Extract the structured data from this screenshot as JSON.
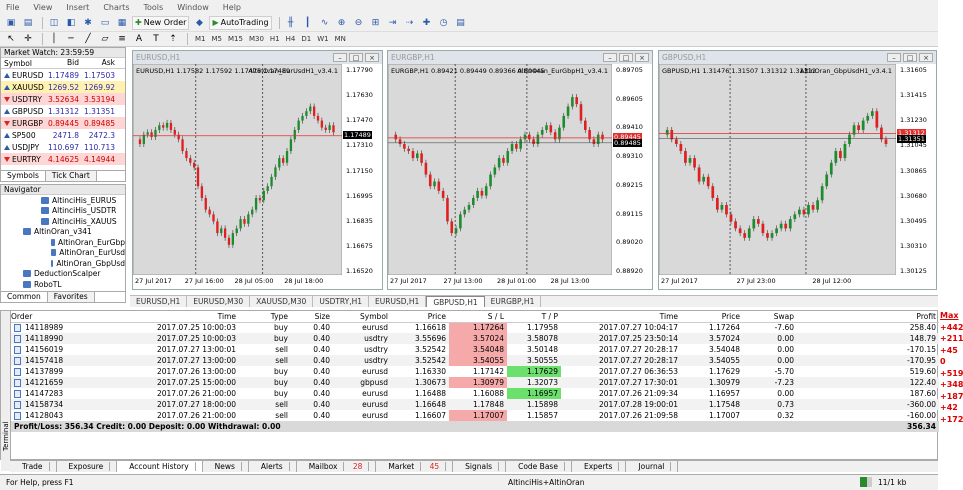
{
  "menu": [
    "File",
    "View",
    "Insert",
    "Charts",
    "Tools",
    "Window",
    "Help"
  ],
  "toolbar": {
    "new_order": "New Order",
    "autotrading": "AutoTrading"
  },
  "timeframes": [
    "M1",
    "M5",
    "M15",
    "M30",
    "H1",
    "H4",
    "D1",
    "W1",
    "MN"
  ],
  "market_watch": {
    "title": "Market Watch: 23:59:59",
    "columns": [
      "Symbol",
      "Bid",
      "Ask"
    ],
    "rows": [
      {
        "symbol": "EURUSD",
        "bid": "1.17489",
        "ask": "1.17503",
        "dir": "up",
        "bg": "#ffffff"
      },
      {
        "symbol": "XAUUSD",
        "bid": "1269.52",
        "ask": "1269.92",
        "dir": "up",
        "bg": "#fff2b0"
      },
      {
        "symbol": "USDTRY",
        "bid": "3.52634",
        "ask": "3.53194",
        "dir": "dn",
        "bg": "#ffd6d6"
      },
      {
        "symbol": "GBPUSD",
        "bid": "1.31312",
        "ask": "1.31351",
        "dir": "up",
        "bg": "#ffffff"
      },
      {
        "symbol": "EURGBP",
        "bid": "0.89445",
        "ask": "0.89485",
        "dir": "dn",
        "bg": "#ffd6d6"
      },
      {
        "symbol": "SP500",
        "bid": "2471.8",
        "ask": "2472.3",
        "dir": "up",
        "bg": "#ffffff"
      },
      {
        "symbol": "USDJPY",
        "bid": "110.697",
        "ask": "110.713",
        "dir": "up",
        "bg": "#ffffff"
      },
      {
        "symbol": "EURTRY",
        "bid": "4.14625",
        "ask": "4.14944",
        "dir": "dn",
        "bg": "#ffd6d6"
      }
    ],
    "tabs": [
      "Symbols",
      "Tick Chart"
    ]
  },
  "navigator": {
    "title": "Navigator",
    "items": [
      {
        "label": "AltinciHis_EURUS",
        "indent": 40
      },
      {
        "label": "AltinciHis_USDTR",
        "indent": 40
      },
      {
        "label": "AltinciHis_XAUUS",
        "indent": 40
      },
      {
        "label": "AltinOran_v341",
        "indent": 22
      },
      {
        "label": "AltinOran_EurGbp",
        "indent": 50
      },
      {
        "label": "AltinOran_EurUsd",
        "indent": 50
      },
      {
        "label": "AltinOran_GbpUsd",
        "indent": 50
      },
      {
        "label": "DeductionScalper",
        "indent": 22
      },
      {
        "label": "RoboTL",
        "indent": 22
      }
    ],
    "tabs": [
      "Common",
      "Favorites"
    ]
  },
  "charts": [
    {
      "title": "EURUSD,H1",
      "info": "EURUSD,H1  1.17582 1.17592 1.17476 1.17489",
      "ea": "AltinOran_EurUsdH1_v3.4.1",
      "price_label": "1.17489",
      "y_ticks": [
        "1.17790",
        "1.17630",
        "1.17470",
        "1.17310",
        "1.17150",
        "1.16995",
        "1.16835",
        "1.16675",
        "1.16520"
      ],
      "x_ticks": [
        "27 Jul 2017",
        "27 Jul 16:00",
        "28 Jul 05:00",
        "28 Jul 18:00"
      ]
    },
    {
      "title": "EURGBP,H1",
      "info": "EURGBP,H1  0.89421 0.89449 0.89366 0.89445",
      "ea": "AltinOran_EurGbpH1_v3.4.1",
      "price_label": "0.89445",
      "price_label2": "0.89485",
      "y_ticks": [
        "0.89705",
        "0.89605",
        "0.89410",
        "0.89310",
        "0.89215",
        "0.89115",
        "0.89020",
        "0.88920"
      ],
      "x_ticks": [
        "27 Jul 2017",
        "27 Jul 13:00",
        "28 Jul 01:00",
        "28 Jul 13:00"
      ]
    },
    {
      "title": "GBPUSD,H1",
      "info": "GBPUSD,H1  1.31476 1.31507 1.31312 1.31312",
      "ea": "AltinOran_GbpUsdH1_v3.4.1",
      "price_label": "1.31312",
      "price_label2": "1.31351",
      "y_ticks": [
        "1.31605",
        "1.31415",
        "1.31230",
        "1.31045",
        "1.30865",
        "1.30680",
        "1.30495",
        "1.30310",
        "1.30125"
      ],
      "x_ticks": [
        "27 Jul 2017",
        "27 Jul 23:00",
        "28 Jul 12:00"
      ]
    }
  ],
  "chart_tabs": [
    "EURUSD,H1",
    "EURUSD,M30",
    "XAUUSD,M30",
    "USDTRY,H1",
    "EURUSD,H1",
    "GBPUSD,H1",
    "EURGBP,H1"
  ],
  "history": {
    "columns": [
      "Order",
      "Time",
      "Type",
      "Size",
      "Symbol",
      "Price",
      "S / L",
      "T / P",
      "Time",
      "Price",
      "Swap",
      "Profit"
    ],
    "rows": [
      {
        "order": "14118989",
        "time": "2017.07.25 10:00:03",
        "type": "buy",
        "size": "0.40",
        "symbol": "eurusd",
        "price": "1.16618",
        "sl": "1.17264",
        "tp": "1.17958",
        "ctime": "2017.07.27 10:04:17",
        "cprice": "1.17264",
        "swap": "-7.60",
        "profit": "258.40",
        "sl_hl": "red",
        "tp_hl": ""
      },
      {
        "order": "14118990",
        "time": "2017.07.25 10:00:03",
        "type": "buy",
        "size": "0.40",
        "symbol": "usdtry",
        "price": "3.55696",
        "sl": "3.57024",
        "tp": "3.58078",
        "ctime": "2017.07.25 23:50:14",
        "cprice": "3.57024",
        "swap": "0.00",
        "profit": "148.79",
        "sl_hl": "red",
        "tp_hl": ""
      },
      {
        "order": "14156019",
        "time": "2017.07.27 13:00:01",
        "type": "sell",
        "size": "0.40",
        "symbol": "usdtry",
        "price": "3.52542",
        "sl": "3.54048",
        "tp": "3.50148",
        "ctime": "2017.07.27 20:28:17",
        "cprice": "3.54048",
        "swap": "0.00",
        "profit": "-170.15",
        "sl_hl": "red",
        "tp_hl": ""
      },
      {
        "order": "14157418",
        "time": "2017.07.27 13:00:00",
        "type": "sell",
        "size": "0.40",
        "symbol": "usdtry",
        "price": "3.52542",
        "sl": "3.54055",
        "tp": "3.50555",
        "ctime": "2017.07.27 20:28:17",
        "cprice": "3.54055",
        "swap": "0.00",
        "profit": "-170.95",
        "sl_hl": "red",
        "tp_hl": ""
      },
      {
        "order": "14137899",
        "time": "2017.07.26 13:00:00",
        "type": "buy",
        "size": "0.40",
        "symbol": "eurusd",
        "price": "1.16330",
        "sl": "1.17142",
        "tp": "1.17629",
        "ctime": "2017.07.27 06:36:53",
        "cprice": "1.17629",
        "swap": "-5.70",
        "profit": "519.60",
        "sl_hl": "",
        "tp_hl": "green"
      },
      {
        "order": "14121659",
        "time": "2017.07.25 15:00:00",
        "type": "buy",
        "size": "0.40",
        "symbol": "gbpusd",
        "price": "1.30673",
        "sl": "1.30979",
        "tp": "1.32073",
        "ctime": "2017.07.27 17:30:01",
        "cprice": "1.30979",
        "swap": "-7.23",
        "profit": "122.40",
        "sl_hl": "red",
        "tp_hl": ""
      },
      {
        "order": "14147283",
        "time": "2017.07.26 21:00:00",
        "type": "buy",
        "size": "0.40",
        "symbol": "eurusd",
        "price": "1.16488",
        "sl": "1.16088",
        "tp": "1.16957",
        "ctime": "2017.07.26 21:09:34",
        "cprice": "1.16957",
        "swap": "0.00",
        "profit": "187.60",
        "sl_hl": "",
        "tp_hl": "green"
      },
      {
        "order": "14158734",
        "time": "2017.07.27 18:00:00",
        "type": "sell",
        "size": "0.40",
        "symbol": "eurusd",
        "price": "1.16648",
        "sl": "1.17848",
        "tp": "1.15898",
        "ctime": "2017.07.28 19:00:01",
        "cprice": "1.17548",
        "swap": "0.73",
        "profit": "-360.00",
        "sl_hl": "",
        "tp_hl": ""
      },
      {
        "order": "14128043",
        "time": "2017.07.26 21:00:00",
        "type": "sell",
        "size": "0.40",
        "symbol": "eurusd",
        "price": "1.16607",
        "sl": "1.17007",
        "tp": "1.15857",
        "ctime": "2017.07.26 21:09:58",
        "cprice": "1.17007",
        "swap": "0.32",
        "profit": "-160.00",
        "sl_hl": "red",
        "tp_hl": ""
      }
    ],
    "total": {
      "label": "Profit/Loss: 356.34  Credit: 0.00  Deposit: 0.00  Withdrawal: 0.00",
      "value": "356.34"
    }
  },
  "terminal_label": "Terminal",
  "bottom_tabs": [
    {
      "label": "Trade",
      "badge": ""
    },
    {
      "label": "Exposure",
      "badge": ""
    },
    {
      "label": "Account History",
      "badge": ""
    },
    {
      "label": "News",
      "badge": ""
    },
    {
      "label": "Alerts",
      "badge": ""
    },
    {
      "label": "Mailbox",
      "badge": "28"
    },
    {
      "label": "Market",
      "badge": "45"
    },
    {
      "label": "Signals",
      "badge": ""
    },
    {
      "label": "Code Base",
      "badge": ""
    },
    {
      "label": "Experts",
      "badge": ""
    },
    {
      "label": "Journal",
      "badge": ""
    }
  ],
  "status": {
    "help": "For Help, press F1",
    "profile": "AltinciHis+AltinOran",
    "traffic": "11/1 kb"
  },
  "side_annotations": [
    "Max",
    "+442",
    "+211",
    "+45",
    "0",
    "+519",
    "+348",
    "+187",
    "+42",
    "+172"
  ],
  "colors": {
    "bull": "#1c8c2c",
    "bear": "#e02020",
    "chart_bg": "#d9d9d9",
    "line_red": "#e03030"
  }
}
